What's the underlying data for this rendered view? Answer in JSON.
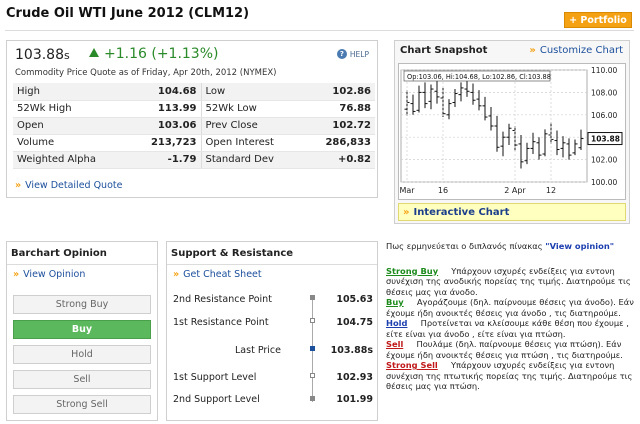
{
  "header": {
    "title": "Crude Oil WTI June 2012 (CLM12)",
    "portfolio_label": "+ Portfolio"
  },
  "quote": {
    "price": "103.88",
    "price_unit": "s",
    "change": "+1.16 (+1.13%)",
    "help_label": "HELP",
    "subline": "Commodity Price Quote as of Friday, Apr 20th, 2012 (NYMEX)",
    "rows": [
      {
        "l1": "High",
        "v1": "104.68",
        "l2": "Low",
        "v2": "102.86"
      },
      {
        "l1": "52Wk High",
        "v1": "113.99",
        "l2": "52Wk Low",
        "v2": "76.88"
      },
      {
        "l1": "Open",
        "v1": "103.06",
        "l2": "Prev Close",
        "v2": "102.72"
      },
      {
        "l1": "Volume",
        "v1": "213,723",
        "l2": "Open Interest",
        "v2": "286,833"
      },
      {
        "l1": "Weighted Alpha",
        "v1": "-1.79",
        "l2": "Standard Dev",
        "v2": "+0.82"
      }
    ],
    "detail_link": "View Detailed Quote"
  },
  "snapshot": {
    "title": "Chart Snapshot",
    "customize": "Customize Chart",
    "ohlc": "Op:103.06, Hi:104.68, Lo:102.86, Cl:103.88",
    "last_label": "103.88",
    "interactive": "Interactive Chart"
  },
  "chart_data": {
    "type": "ohlc",
    "ylim": [
      100.0,
      110.0
    ],
    "y_ticks": [
      "110.00",
      "108.00",
      "106.00",
      "104.00",
      "102.00",
      "100.00"
    ],
    "x_ticks": [
      "Mar",
      "16",
      "2 Apr",
      "12"
    ],
    "bars": [
      {
        "o": 106.5,
        "h": 108.2,
        "l": 105.9,
        "c": 107.1
      },
      {
        "o": 107.0,
        "h": 107.8,
        "l": 106.0,
        "c": 106.3
      },
      {
        "o": 106.4,
        "h": 108.6,
        "l": 106.2,
        "c": 108.0
      },
      {
        "o": 108.0,
        "h": 108.9,
        "l": 106.6,
        "c": 107.0
      },
      {
        "o": 107.2,
        "h": 108.7,
        "l": 106.5,
        "c": 108.3
      },
      {
        "o": 108.1,
        "h": 109.2,
        "l": 107.0,
        "c": 107.6
      },
      {
        "o": 107.5,
        "h": 108.4,
        "l": 105.8,
        "c": 106.1
      },
      {
        "o": 106.0,
        "h": 107.4,
        "l": 105.6,
        "c": 107.0
      },
      {
        "o": 107.1,
        "h": 108.3,
        "l": 106.7,
        "c": 107.9
      },
      {
        "o": 107.8,
        "h": 108.9,
        "l": 107.2,
        "c": 108.4
      },
      {
        "o": 108.3,
        "h": 109.3,
        "l": 107.6,
        "c": 108.1
      },
      {
        "o": 108.0,
        "h": 108.8,
        "l": 106.9,
        "c": 107.3
      },
      {
        "o": 107.4,
        "h": 108.2,
        "l": 106.4,
        "c": 106.8
      },
      {
        "o": 106.8,
        "h": 107.6,
        "l": 105.5,
        "c": 105.8
      },
      {
        "o": 105.9,
        "h": 106.7,
        "l": 104.6,
        "c": 105.0
      },
      {
        "o": 105.0,
        "h": 105.9,
        "l": 102.7,
        "c": 103.1
      },
      {
        "o": 103.2,
        "h": 104.5,
        "l": 102.3,
        "c": 104.0
      },
      {
        "o": 104.0,
        "h": 105.2,
        "l": 103.3,
        "c": 104.8
      },
      {
        "o": 104.6,
        "h": 105.0,
        "l": 102.8,
        "c": 103.3
      },
      {
        "o": 103.4,
        "h": 104.2,
        "l": 101.2,
        "c": 101.8
      },
      {
        "o": 101.9,
        "h": 103.5,
        "l": 101.6,
        "c": 103.0
      },
      {
        "o": 103.0,
        "h": 104.4,
        "l": 102.5,
        "c": 103.6
      },
      {
        "o": 103.5,
        "h": 104.0,
        "l": 102.0,
        "c": 102.4
      },
      {
        "o": 102.5,
        "h": 104.7,
        "l": 102.3,
        "c": 104.3
      },
      {
        "o": 104.2,
        "h": 105.3,
        "l": 103.4,
        "c": 103.8
      },
      {
        "o": 103.7,
        "h": 104.6,
        "l": 102.4,
        "c": 102.9
      },
      {
        "o": 103.0,
        "h": 104.1,
        "l": 102.2,
        "c": 103.5
      },
      {
        "o": 103.4,
        "h": 103.9,
        "l": 102.0,
        "c": 102.4
      },
      {
        "o": 102.6,
        "h": 103.8,
        "l": 102.4,
        "c": 103.4
      },
      {
        "o": 103.06,
        "h": 104.68,
        "l": 102.86,
        "c": 103.88
      }
    ]
  },
  "opinion": {
    "title": "Barchart Opinion",
    "view_link": "View Opinion",
    "buttons": [
      "Strong Buy",
      "Buy",
      "Hold",
      "Sell",
      "Strong Sell"
    ]
  },
  "support": {
    "title": "Support & Resistance",
    "link": "Get Cheat Sheet",
    "rows": [
      {
        "label": "2nd Resistance Point",
        "value": "105.63"
      },
      {
        "label": "1st Resistance Point",
        "value": "104.75"
      },
      {
        "label": "Last Price",
        "value": "103.88s"
      },
      {
        "label": "1st Support Level",
        "value": "102.93"
      },
      {
        "label": "2nd Support Level",
        "value": "101.99"
      }
    ]
  },
  "legend": {
    "intro": "Πως ερμηνεύεται ο διπλανός πίνακας",
    "intro_link": "\"View opinion\"",
    "items": [
      {
        "term": "Strong Buy",
        "text": "Υπάρχουν ισχυρές ενδείξεις για εντονη συνέχιση της ανοδικής πορείας της τιμής. Διατηρούμε τις θέσεις μας για άνοδο."
      },
      {
        "term": "Buy",
        "text": "Αγοράζουμε (δηλ. παίρνουμε θέσεις για άνοδο). Εάν έχουμε ήδη ανοικτές θέσεις για άνοδο , τις διατηρούμε."
      },
      {
        "term": "Hold",
        "text": "Προτείνεται να κλείσουμε κάθε θέση που έχουμε , είτε είναι για άνοδο , είτε είναι για πτώση."
      },
      {
        "term": "Sell",
        "text": "Πουλάμε (δηλ. παίρνουμε θέσεις για πτώση). Εάν έχουμε ήδη ανοικτές θέσεις για πτώση , τις διατηρούμε."
      },
      {
        "term": "Strong Sell",
        "text": "Υπάρχουν ισχυρές ενδείξεις για εντονη συνέχιση της πτωτικής πορείας της τιμής. Διατηρούμε τις θέσεις μας για πτώση."
      }
    ]
  }
}
